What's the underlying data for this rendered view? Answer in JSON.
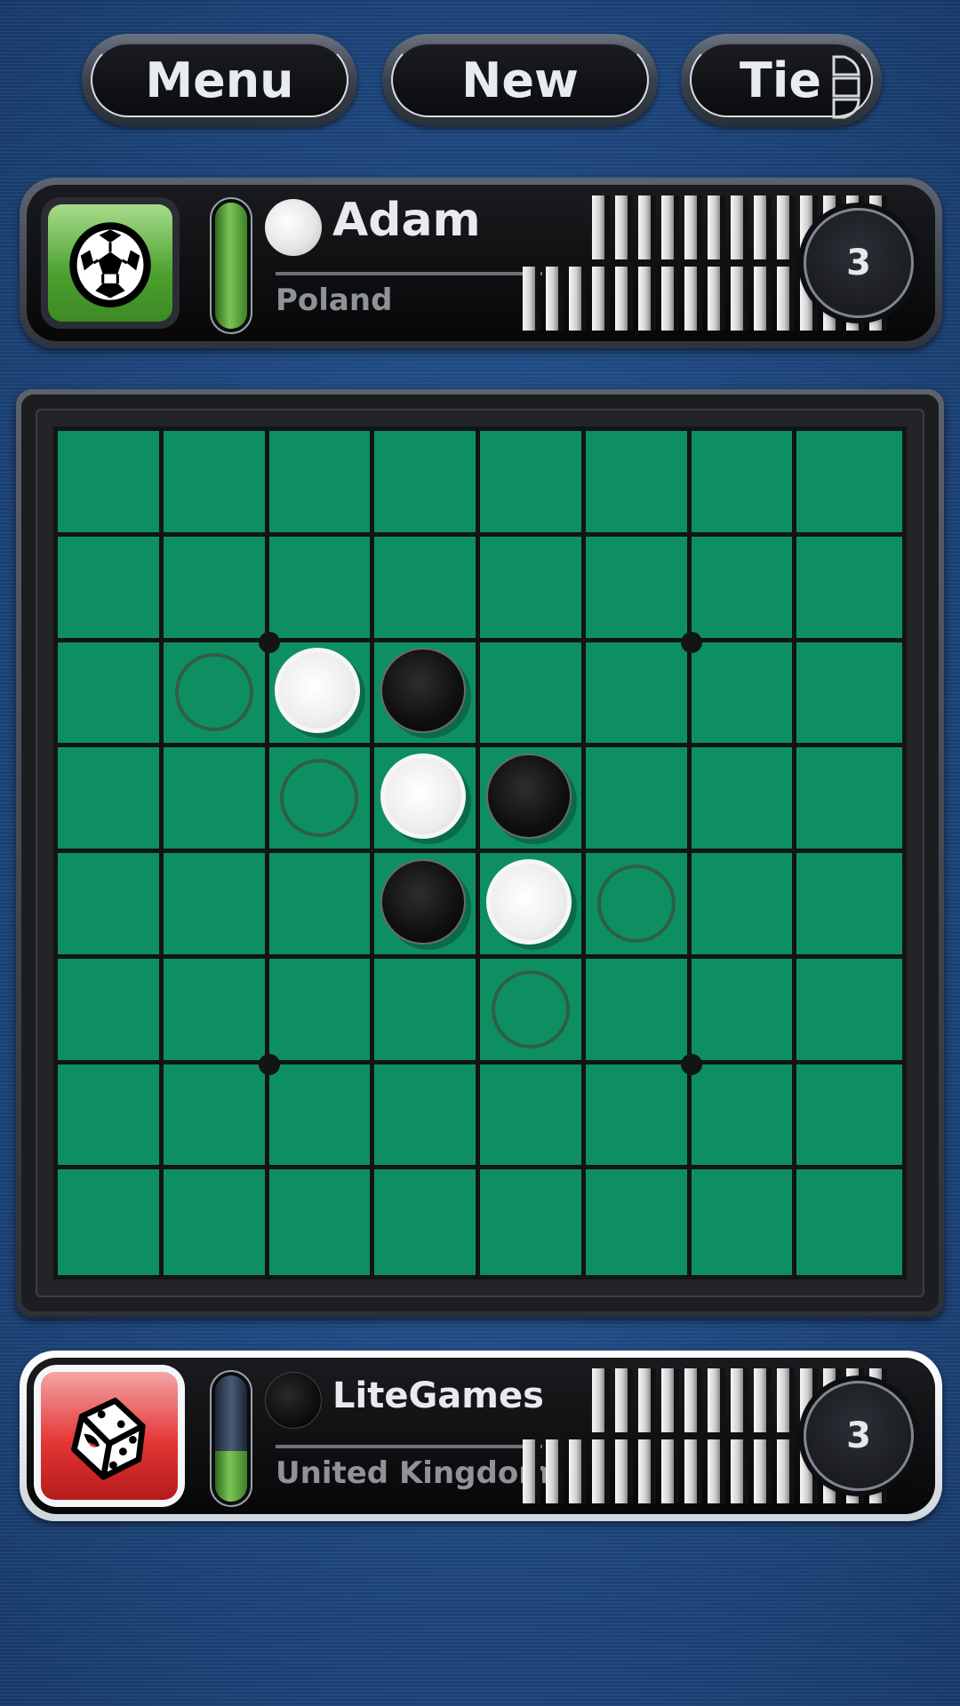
{
  "toolbar": {
    "menu_label": "Menu",
    "new_label": "New",
    "tie_label": "Tie",
    "tie_indicator_segments": 3
  },
  "players": {
    "top": {
      "name": "Adam",
      "country": "Poland",
      "avatar_icon": "soccer-ball-icon",
      "avatar_color": "#4aa02f",
      "disc_color": "white",
      "score": "3",
      "timer_fraction": 1.0,
      "active": false,
      "stack_row1_count": 13,
      "stack_row2_count": 16
    },
    "bottom": {
      "name": "LiteGames",
      "country": "United Kingdom",
      "avatar_icon": "dice-icon",
      "avatar_color": "#e43535",
      "disc_color": "black",
      "score": "3",
      "timer_fraction": 0.4,
      "active": true,
      "stack_row1_count": 13,
      "stack_row2_count": 16
    }
  },
  "board": {
    "size": 8,
    "colors": {
      "felt": "#0e8f62",
      "grid": "#121416",
      "hint": "#2f5e45"
    },
    "cells": [
      {
        "row": 2,
        "col": 1,
        "state": "hint"
      },
      {
        "row": 2,
        "col": 2,
        "state": "white"
      },
      {
        "row": 2,
        "col": 3,
        "state": "black"
      },
      {
        "row": 3,
        "col": 2,
        "state": "hint"
      },
      {
        "row": 3,
        "col": 3,
        "state": "white"
      },
      {
        "row": 3,
        "col": 4,
        "state": "black"
      },
      {
        "row": 4,
        "col": 3,
        "state": "black"
      },
      {
        "row": 4,
        "col": 4,
        "state": "white"
      },
      {
        "row": 4,
        "col": 5,
        "state": "hint"
      },
      {
        "row": 5,
        "col": 4,
        "state": "hint"
      }
    ],
    "star_points": [
      [
        2,
        2
      ],
      [
        2,
        6
      ],
      [
        6,
        2
      ],
      [
        6,
        6
      ]
    ]
  }
}
